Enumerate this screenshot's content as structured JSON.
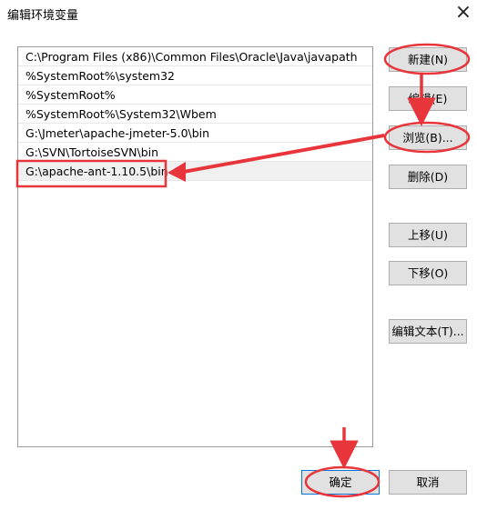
{
  "window": {
    "title": "编辑环境变量",
    "close_glyph": "×"
  },
  "list": {
    "items": [
      {
        "label": "C:\\Program Files (x86)\\Common Files\\Oracle\\Java\\javapath"
      },
      {
        "label": "%SystemRoot%\\system32"
      },
      {
        "label": "%SystemRoot%"
      },
      {
        "label": "%SystemRoot%\\System32\\Wbem"
      },
      {
        "label": "G:\\Jmeter\\apache-jmeter-5.0\\bin"
      },
      {
        "label": "G:\\SVN\\TortoiseSVN\\bin"
      },
      {
        "label": "G:\\apache-ant-1.10.5\\bin"
      }
    ],
    "selected_index": 6
  },
  "buttons": {
    "new": "新建(N)",
    "edit": "编辑(E)",
    "browse": "浏览(B)...",
    "delete": "删除(D)",
    "move_up": "上移(U)",
    "move_down": "下移(O)",
    "edit_text": "编辑文本(T)...",
    "ok": "确定",
    "cancel": "取消"
  },
  "annotation_color": "#e8353b"
}
